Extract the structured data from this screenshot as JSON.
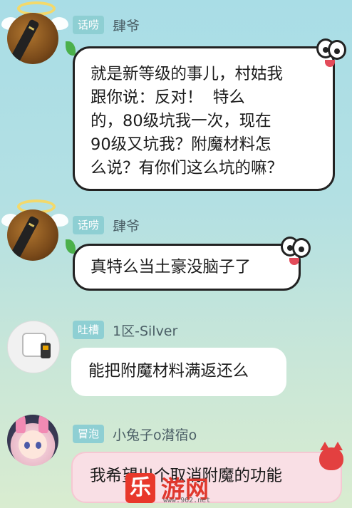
{
  "messages": [
    {
      "tag": "话唠",
      "username": "肆爷",
      "text": "就是新等级的事儿，村姑我\n跟你说：反对！  特么\n的，80级坑我一次，现在\n90级又坑我？附魔材料怎\n么说？有你们这么坑的嘛？"
    },
    {
      "tag": "话唠",
      "username": "肆爷",
      "text": "真特么当土豪没脑子了"
    },
    {
      "tag": "吐槽",
      "username": "1区-Silver",
      "text": "能把附魔材料满返还么"
    },
    {
      "tag": "冒泡",
      "username": "小兔子o潸宿o",
      "text": "我希望出个取消附魔的功能"
    }
  ],
  "watermark": {
    "logo": "乐",
    "title": "游网",
    "url": "www.962.net"
  },
  "colors": {
    "tag_bg": "#8ecfd3",
    "bubble_pink": "#f9dfe5",
    "watermark_red": "#e0382d"
  }
}
